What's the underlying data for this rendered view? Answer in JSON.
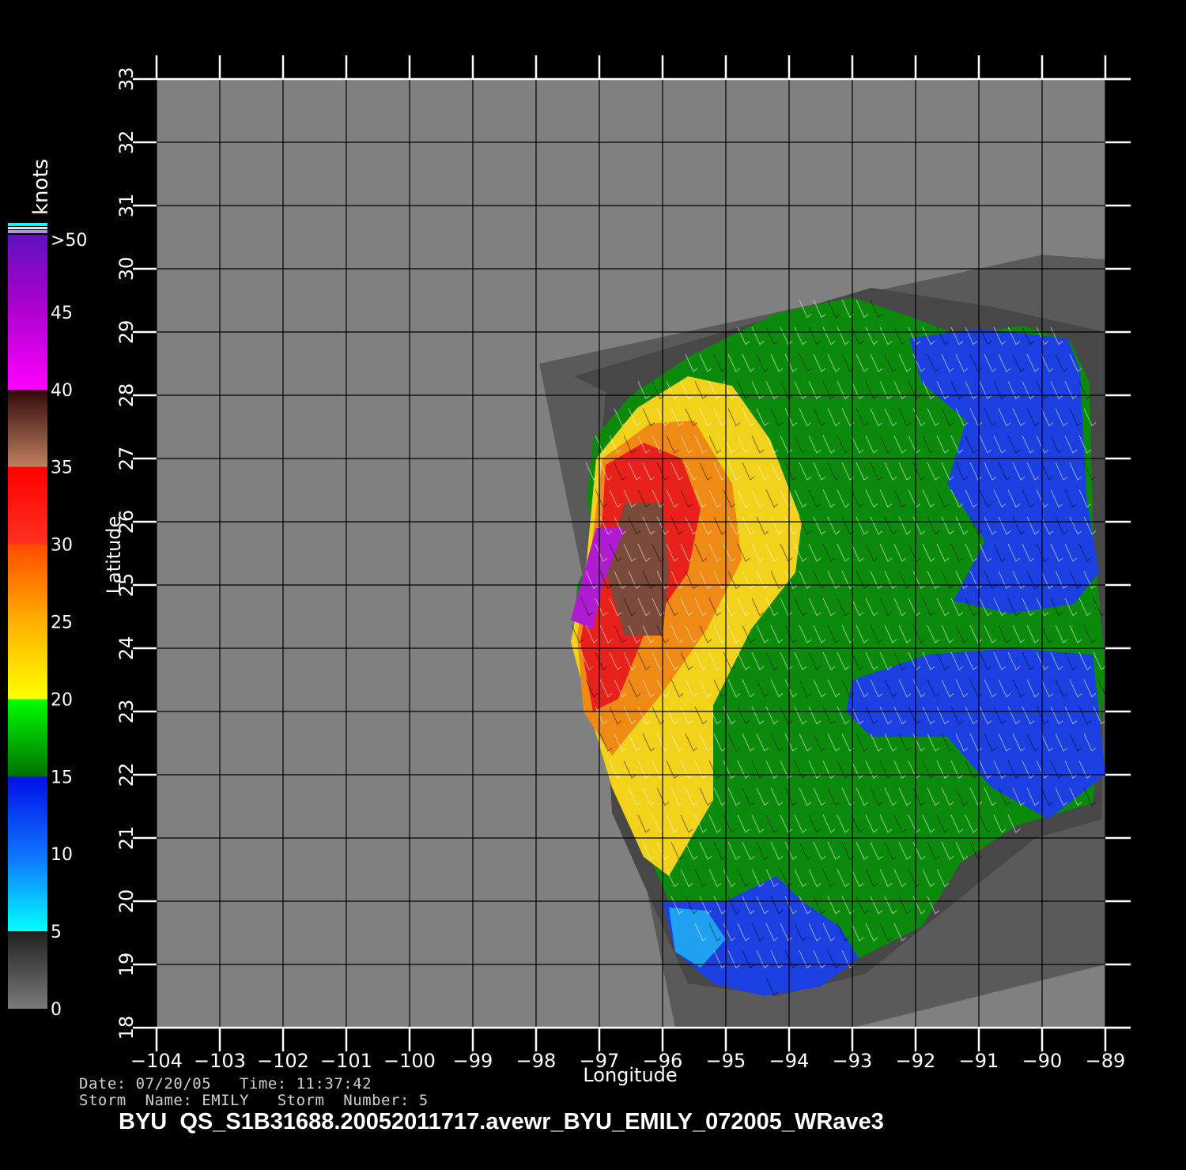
{
  "map": {
    "x_axis": {
      "label": "Longitude",
      "range": [
        -104,
        -89
      ],
      "ticks": [
        -104,
        -103,
        -102,
        -101,
        -100,
        -99,
        -98,
        -97,
        -96,
        -95,
        -94,
        -93,
        -92,
        -91,
        -90,
        -89
      ],
      "tick_labels": [
        "−104",
        "−103",
        "−102",
        "−101",
        "−100",
        "−99",
        "−98",
        "−97",
        "−96",
        "−95",
        "−94",
        "−93",
        "−92",
        "−91",
        "−90",
        "−89"
      ]
    },
    "y_axis": {
      "label": "Latitude",
      "range": [
        18,
        33
      ],
      "ticks": [
        18,
        19,
        20,
        21,
        22,
        23,
        24,
        25,
        26,
        27,
        28,
        29,
        30,
        31,
        32,
        33
      ],
      "tick_labels": [
        "18",
        "19",
        "20",
        "21",
        "22",
        "23",
        "24",
        "25",
        "26",
        "27",
        "28",
        "29",
        "30",
        "31",
        "32",
        "33"
      ]
    },
    "grid": true,
    "background_color": "#808080",
    "swath_bands": [
      {
        "name": "outer",
        "color": "#5a5a5a",
        "polygon": [
          [
            -97.95,
            28.5
          ],
          [
            -90.0,
            30.22
          ],
          [
            -89.0,
            30.15
          ],
          [
            -89.0,
            19.0
          ],
          [
            -93.0,
            18.0
          ],
          [
            -95.8,
            18.0
          ]
        ]
      },
      {
        "name": "inner",
        "color": "#474747",
        "polygon": [
          [
            -97.4,
            28.3
          ],
          [
            -96.9,
            28.05
          ],
          [
            -97.05,
            26.1
          ],
          [
            -96.8,
            21.4
          ],
          [
            -95.6,
            18.7
          ],
          [
            -94.2,
            18.5
          ],
          [
            -92.8,
            18.85
          ],
          [
            -90.1,
            21.0
          ],
          [
            -89.05,
            21.3
          ],
          [
            -89.0,
            29.0
          ],
          [
            -90.8,
            29.4
          ],
          [
            -92.7,
            29.7
          ]
        ]
      }
    ],
    "wind_field": [
      {
        "speed_band": "15-20",
        "color": "#0c8a0c",
        "polygon": [
          [
            -97.1,
            27.3
          ],
          [
            -96.5,
            28.0
          ],
          [
            -95.6,
            28.6
          ],
          [
            -94.2,
            29.3
          ],
          [
            -93.0,
            29.55
          ],
          [
            -92.1,
            29.25
          ],
          [
            -91.3,
            28.95
          ],
          [
            -90.3,
            29.1
          ],
          [
            -89.55,
            28.85
          ],
          [
            -89.25,
            28.2
          ],
          [
            -89.2,
            26.0
          ],
          [
            -89.0,
            23.6
          ],
          [
            -89.2,
            21.55
          ],
          [
            -90.4,
            21.2
          ],
          [
            -91.3,
            20.6
          ],
          [
            -91.9,
            19.6
          ],
          [
            -92.9,
            19.1
          ],
          [
            -94.2,
            18.6
          ],
          [
            -95.1,
            19.0
          ],
          [
            -95.9,
            20.0
          ],
          [
            -96.6,
            21.6
          ],
          [
            -97.0,
            22.6
          ],
          [
            -97.4,
            24.1
          ],
          [
            -97.35,
            25.0
          ],
          [
            -97.05,
            25.6
          ],
          [
            -97.2,
            26.4
          ]
        ]
      },
      {
        "speed_band": "20-25",
        "color": "#f2d21a",
        "polygon": [
          [
            -97.05,
            27.0
          ],
          [
            -96.4,
            27.8
          ],
          [
            -95.6,
            28.3
          ],
          [
            -94.9,
            28.15
          ],
          [
            -94.3,
            27.3
          ],
          [
            -93.8,
            26.0
          ],
          [
            -93.9,
            25.2
          ],
          [
            -94.6,
            24.3
          ],
          [
            -95.2,
            23.1
          ],
          [
            -95.2,
            21.6
          ],
          [
            -95.9,
            20.4
          ],
          [
            -96.3,
            20.7
          ],
          [
            -96.8,
            21.8
          ],
          [
            -97.1,
            22.8
          ],
          [
            -97.45,
            24.1
          ],
          [
            -97.2,
            25.4
          ]
        ]
      },
      {
        "speed_band": "25-30",
        "color": "#ef8a15",
        "polygon": [
          [
            -96.95,
            27.0
          ],
          [
            -96.2,
            27.55
          ],
          [
            -95.5,
            27.6
          ],
          [
            -94.9,
            26.6
          ],
          [
            -94.75,
            25.4
          ],
          [
            -95.3,
            24.3
          ],
          [
            -96.0,
            23.3
          ],
          [
            -96.8,
            22.3
          ],
          [
            -97.25,
            23.0
          ],
          [
            -97.35,
            24.2
          ],
          [
            -97.15,
            25.4
          ]
        ]
      },
      {
        "speed_band": "30-35",
        "color": "#e8211a",
        "polygon": [
          [
            -96.9,
            26.9
          ],
          [
            -96.3,
            27.25
          ],
          [
            -95.7,
            27.0
          ],
          [
            -95.4,
            26.2
          ],
          [
            -95.6,
            25.2
          ],
          [
            -96.3,
            24.2
          ],
          [
            -96.7,
            23.2
          ],
          [
            -97.1,
            23.0
          ],
          [
            -97.3,
            24.1
          ],
          [
            -97.1,
            25.3
          ],
          [
            -96.95,
            26.1
          ]
        ]
      },
      {
        "speed_band": "35-40",
        "color": "#7a4a3a",
        "polygon": [
          [
            -96.6,
            26.3
          ],
          [
            -96.0,
            26.3
          ],
          [
            -95.9,
            25.2
          ],
          [
            -96.0,
            24.2
          ],
          [
            -96.6,
            24.2
          ],
          [
            -96.9,
            25.2
          ]
        ]
      },
      {
        "speed_band": ">40",
        "color": "#b01ad0",
        "polygon": [
          [
            -97.45,
            24.45
          ],
          [
            -97.1,
            24.3
          ],
          [
            -96.95,
            25.0
          ],
          [
            -96.6,
            25.9
          ],
          [
            -97.05,
            25.9
          ],
          [
            -97.3,
            25.0
          ]
        ]
      },
      {
        "speed_band": "10-15",
        "color": "#1b3fe0",
        "polygon": [
          [
            -92.1,
            28.9
          ],
          [
            -91.0,
            29.05
          ],
          [
            -89.6,
            28.9
          ],
          [
            -89.4,
            28.4
          ],
          [
            -89.3,
            26.4
          ],
          [
            -89.1,
            25.2
          ],
          [
            -89.5,
            24.7
          ],
          [
            -90.5,
            24.55
          ],
          [
            -91.4,
            24.75
          ],
          [
            -90.9,
            25.7
          ],
          [
            -91.5,
            26.6
          ],
          [
            -91.2,
            27.6
          ],
          [
            -91.9,
            28.2
          ]
        ]
      },
      {
        "speed_band": "10-15",
        "color": "#1b3fe0",
        "polygon": [
          [
            -93.0,
            23.5
          ],
          [
            -91.8,
            23.9
          ],
          [
            -90.5,
            24.0
          ],
          [
            -89.2,
            23.9
          ],
          [
            -89.0,
            22.0
          ],
          [
            -89.9,
            21.3
          ],
          [
            -90.8,
            21.8
          ],
          [
            -91.5,
            22.6
          ],
          [
            -92.7,
            22.6
          ],
          [
            -93.1,
            23.0
          ]
        ]
      },
      {
        "speed_band": "10-15",
        "color": "#1b3fe0",
        "polygon": [
          [
            -96.0,
            20.0
          ],
          [
            -95.0,
            20.0
          ],
          [
            -94.2,
            20.4
          ],
          [
            -93.8,
            20.0
          ],
          [
            -93.2,
            19.6
          ],
          [
            -92.9,
            19.1
          ],
          [
            -93.5,
            18.65
          ],
          [
            -94.4,
            18.5
          ],
          [
            -95.2,
            18.7
          ],
          [
            -95.8,
            19.2
          ]
        ]
      },
      {
        "speed_band": "5-10",
        "color": "#1fa0f0",
        "polygon": [
          [
            -95.9,
            19.9
          ],
          [
            -95.3,
            19.85
          ],
          [
            -95.0,
            19.4
          ],
          [
            -95.4,
            18.95
          ],
          [
            -95.8,
            19.2
          ]
        ]
      }
    ],
    "wind_vectors": {
      "rows": 28,
      "cols": 40,
      "color": "#ffffff",
      "secondary_color": "#000000"
    }
  },
  "colorbar": {
    "unit_label": "knots",
    "range": [
      0,
      50
    ],
    "stops": [
      {
        "v": 0,
        "color": "#7a7a7a"
      },
      {
        "v": 5,
        "color": "#202020"
      },
      {
        "v": 5,
        "color": "#00ffff"
      },
      {
        "v": 10,
        "color": "#1070ff"
      },
      {
        "v": 15,
        "color": "#0010e8"
      },
      {
        "v": 15,
        "color": "#007000"
      },
      {
        "v": 20,
        "color": "#00ff00"
      },
      {
        "v": 20,
        "color": "#ffff00"
      },
      {
        "v": 25,
        "color": "#ffb000"
      },
      {
        "v": 30,
        "color": "#ff4a00"
      },
      {
        "v": 30,
        "color": "#ff3020"
      },
      {
        "v": 35,
        "color": "#ff0000"
      },
      {
        "v": 35,
        "color": "#c08060"
      },
      {
        "v": 40,
        "color": "#300808"
      },
      {
        "v": 40,
        "color": "#ff00ff"
      },
      {
        "v": 45,
        "color": "#b000d0"
      },
      {
        "v": 50,
        "color": "#6010c0"
      }
    ],
    "labels": [
      {
        "v": 0,
        "text": "0"
      },
      {
        "v": 5,
        "text": "5"
      },
      {
        "v": 10,
        "text": "10"
      },
      {
        "v": 15,
        "text": "15"
      },
      {
        "v": 20,
        "text": "20"
      },
      {
        "v": 25,
        "text": "25"
      },
      {
        "v": 30,
        "text": "30"
      },
      {
        "v": 35,
        "text": "35"
      },
      {
        "v": 40,
        "text": "40"
      },
      {
        "v": 45,
        "text": "45"
      },
      {
        "v": 50,
        "text": ">50"
      }
    ]
  },
  "info": {
    "date_line": "Date: 07/20/05   Time: 11:37:42",
    "storm_line": "Storm  Name: EMILY   Storm  Number: 5"
  },
  "title": "BYU  QS_S1B31688.20052011717.avewr_BYU_EMILY_072005_WRave3"
}
